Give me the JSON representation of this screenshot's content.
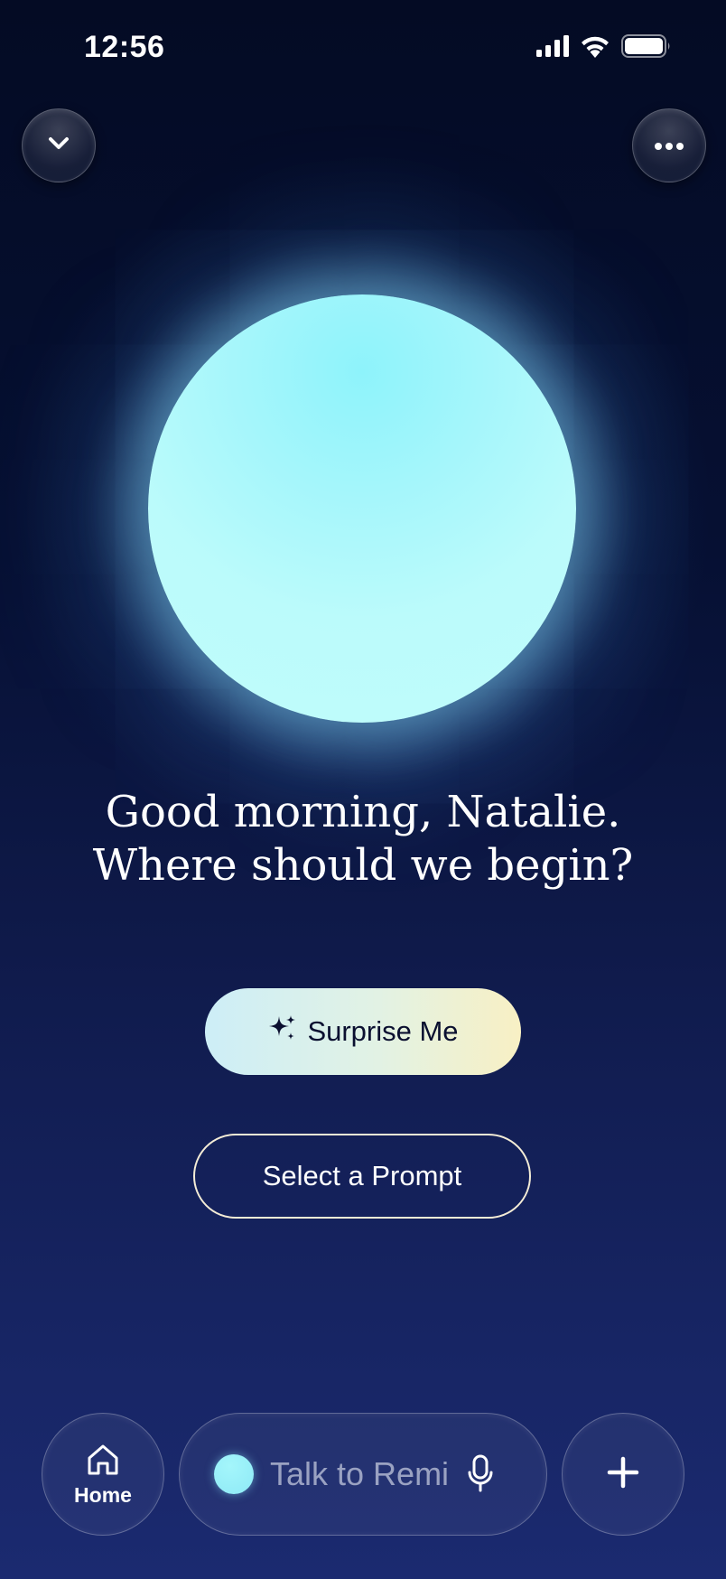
{
  "status_bar": {
    "time": "12:56",
    "icons": [
      "signal-icon",
      "wifi-icon",
      "battery-icon"
    ]
  },
  "top_controls": {
    "left_icon": "chevron-down-icon",
    "right_icon": "more-icon"
  },
  "orb": {
    "color": "#a5f6fb",
    "glow_color": "#78c8f0"
  },
  "greeting": {
    "line1": "Good morning, Natalie.",
    "line2": "Where should we begin?"
  },
  "actions": {
    "surprise_label": "Surprise Me",
    "surprise_icon": "sparkles-icon",
    "prompt_label": "Select a Prompt"
  },
  "bottom_bar": {
    "home_label": "Home",
    "home_icon": "home-icon",
    "talk_placeholder": "Talk to Remi",
    "mic_icon": "microphone-icon",
    "plus_icon": "plus-icon"
  },
  "colors": {
    "background_top": "#040b24",
    "background_bottom": "#1b2a70",
    "surprise_gradient_start": "#cdeef7",
    "surprise_gradient_end": "#f8f0c4",
    "prompt_border": "#f4ecd6"
  }
}
